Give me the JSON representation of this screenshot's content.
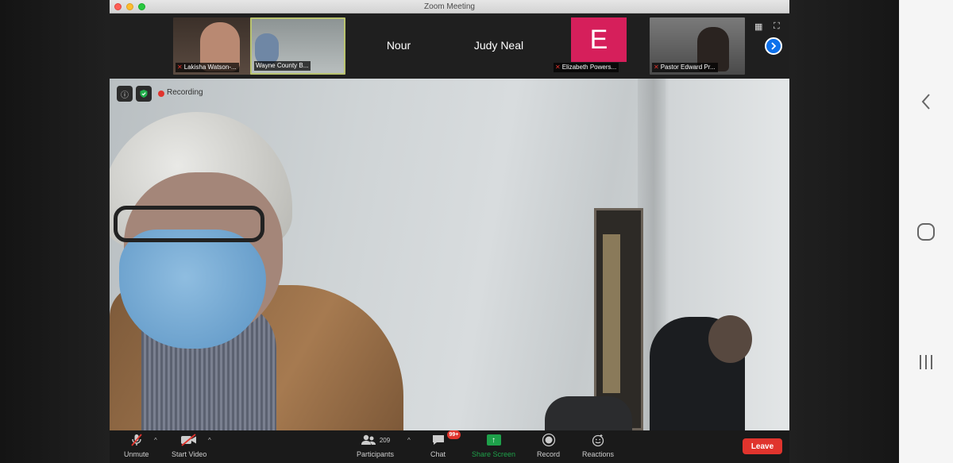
{
  "window": {
    "title": "Zoom Meeting"
  },
  "strip": {
    "tiles": [
      {
        "name": "Lakisha Watson-...",
        "muted": true
      },
      {
        "name": "Wayne County B...",
        "muted": false,
        "active": true
      },
      {
        "name": "Nour"
      },
      {
        "name": "Judy Neal"
      },
      {
        "name": "Elizabeth Powers...",
        "avatar_letter": "E",
        "muted": true,
        "avatar_color": "#d61f5b"
      },
      {
        "name": "Pastor Edward Pr...",
        "muted": true
      }
    ]
  },
  "recording": {
    "label": "Recording"
  },
  "toolbar": {
    "unmute": "Unmute",
    "start_video": "Start Video",
    "participants": "Participants",
    "participants_count": "209",
    "chat": "Chat",
    "chat_badge": "99+",
    "share_screen": "Share Screen",
    "record": "Record",
    "reactions": "Reactions",
    "leave": "Leave"
  },
  "colors": {
    "accent": "#0e71eb",
    "leave": "#e0342d",
    "share": "#1ea14a"
  },
  "icons": [
    "grid-icon",
    "fullscreen-icon",
    "next-page-icon",
    "info-icon",
    "shield-icon",
    "mic-off-icon",
    "video-off-icon",
    "participants-icon",
    "chat-icon",
    "share-screen-icon",
    "record-icon",
    "reactions-icon",
    "back-icon",
    "home-icon",
    "recents-icon"
  ]
}
